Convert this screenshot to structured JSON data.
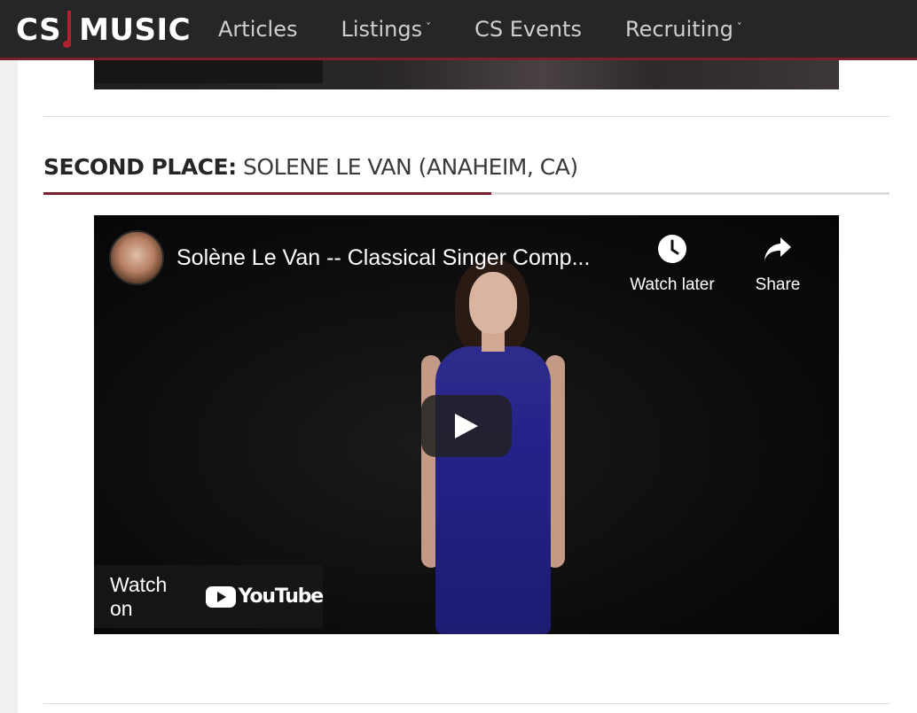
{
  "nav": {
    "logo_left": "CS",
    "logo_right": "MUSIC",
    "items": [
      {
        "label": "Articles",
        "has_dropdown": false
      },
      {
        "label": "Listings",
        "has_dropdown": true
      },
      {
        "label": "CS Events",
        "has_dropdown": false
      },
      {
        "label": "Recruiting",
        "has_dropdown": true
      }
    ],
    "dropdown_glyph": "˅"
  },
  "section": {
    "heading_prefix": "SECOND PLACE:",
    "heading_name": "SOLENE LE VAN (ANAHEIM, CA)"
  },
  "video": {
    "title": "Solène Le Van -- Classical Singer Comp...",
    "watch_later_label": "Watch later",
    "share_label": "Share",
    "watch_on_label": "Watch on",
    "youtube_wordmark": "YouTube"
  },
  "colors": {
    "nav_bg": "#262626",
    "accent": "#7a1f2b",
    "youtube_red": "#ffffff"
  }
}
